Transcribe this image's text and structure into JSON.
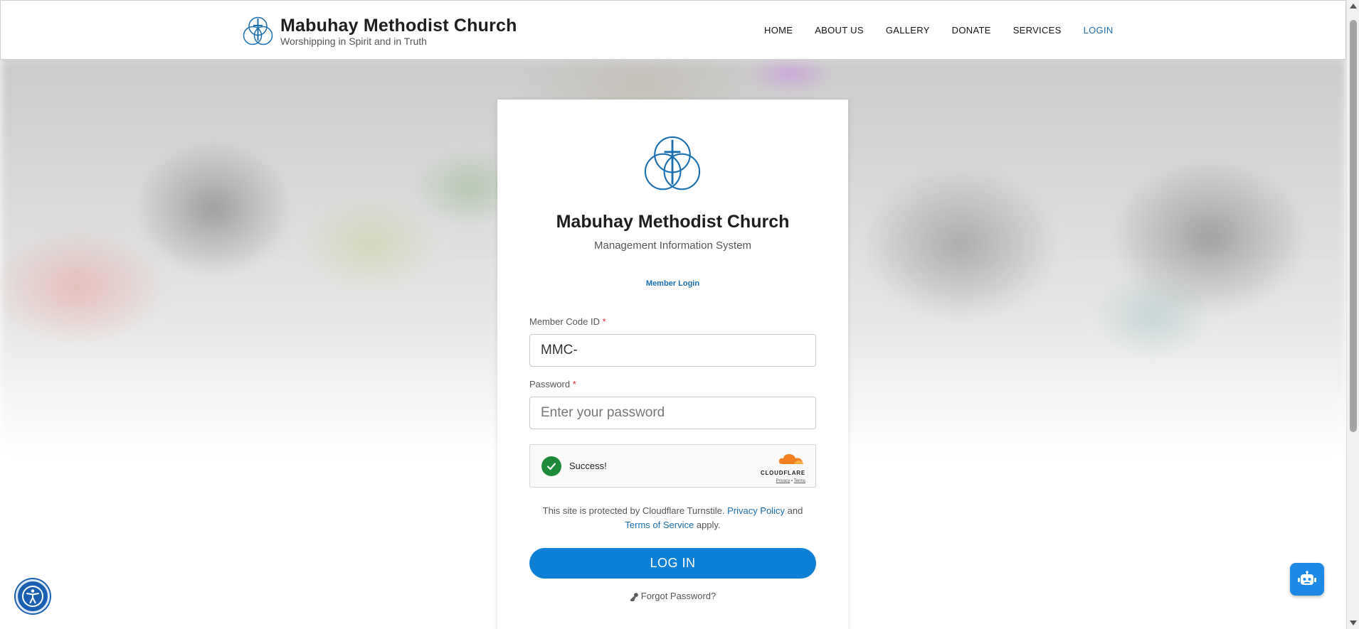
{
  "header": {
    "title": "Mabuhay Methodist Church",
    "subtitle": "Worshipping in Spirit and in Truth",
    "nav": [
      {
        "label": "HOME"
      },
      {
        "label": "ABOUT US"
      },
      {
        "label": "GALLERY"
      },
      {
        "label": "DONATE"
      },
      {
        "label": "SERVICES"
      },
      {
        "label": "LOGIN",
        "active": true
      }
    ]
  },
  "card": {
    "title": "Mabuhay Methodist Church",
    "subtitle": "Management Information System",
    "tab_label": "Member Login",
    "member_code": {
      "label": "Member Code ID",
      "required_mark": "*",
      "value": "MMC-"
    },
    "password": {
      "label": "Password",
      "required_mark": "*",
      "placeholder": "Enter your password"
    },
    "turnstile": {
      "status": "Success!",
      "brand": "CLOUDFLARE",
      "privacy": "Privacy",
      "separator": "•",
      "terms": "Terms"
    },
    "notice": {
      "text_before": "This site is protected by Cloudflare Turnstile.",
      "privacy_link": "Privacy Policy",
      "and": "and",
      "terms_link": "Terms of Service",
      "text_after": "apply."
    },
    "login_button": "LOG IN",
    "forgot_password": "Forgot Password?"
  },
  "colors": {
    "accent": "#1a6fb0",
    "button": "#0d80d6",
    "success": "#1d8a3a",
    "required": "#d42a2a"
  },
  "icons": {
    "church_logo": "church-logo-icon",
    "accessibility": "accessibility-icon",
    "chatbot": "robot-icon",
    "key": "key-icon",
    "check": "check-icon"
  }
}
